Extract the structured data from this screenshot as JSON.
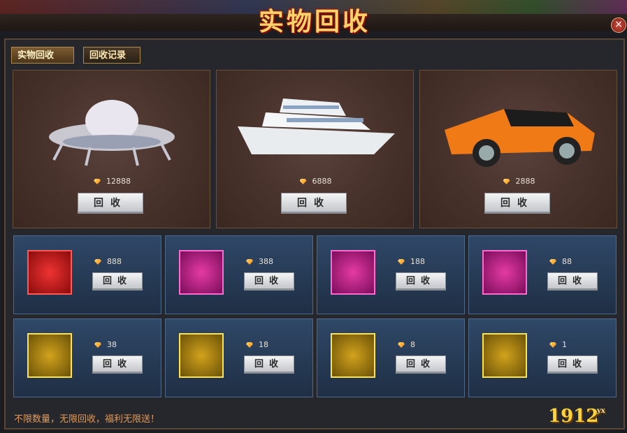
{
  "header": {
    "title": "实物回收",
    "close_glyph": "×"
  },
  "tabs": [
    {
      "label": "实物回收",
      "active": true
    },
    {
      "label": "回收记录",
      "active": false
    }
  ],
  "big_items": [
    {
      "name": "ufo",
      "icon": "ufo-icon",
      "price": "12888",
      "button": "回收"
    },
    {
      "name": "yacht",
      "icon": "yacht-icon",
      "price": "6888",
      "button": "回收"
    },
    {
      "name": "sports-car",
      "icon": "sports-car-icon",
      "price": "2888",
      "button": "回收"
    }
  ],
  "small_items_row1": [
    {
      "icon": "drone-icon",
      "frame": "red",
      "price": "888",
      "button": "回收"
    },
    {
      "icon": "toothbrush-icon",
      "frame": "pink",
      "price": "388",
      "button": "回收"
    },
    {
      "icon": "headphones-icon",
      "frame": "pink",
      "price": "188",
      "button": "回收"
    },
    {
      "icon": "fan-icon",
      "frame": "pink",
      "price": "88",
      "button": "回收"
    }
  ],
  "small_items_row2": [
    {
      "icon": "hair-dryer-icon",
      "frame": "gold",
      "price": "38",
      "button": "回收"
    },
    {
      "icon": "ice-cream-icon",
      "frame": "gold",
      "price": "18",
      "button": "回收"
    },
    {
      "icon": "soap-icon",
      "frame": "gold",
      "price": "8",
      "button": "回收"
    },
    {
      "icon": "gum-icon",
      "frame": "gold",
      "price": "1",
      "button": "回收"
    }
  ],
  "footer": {
    "text": "不限数量，无限回收，福利无限送！"
  },
  "logo": {
    "text": "1912",
    "badge": "yx"
  }
}
